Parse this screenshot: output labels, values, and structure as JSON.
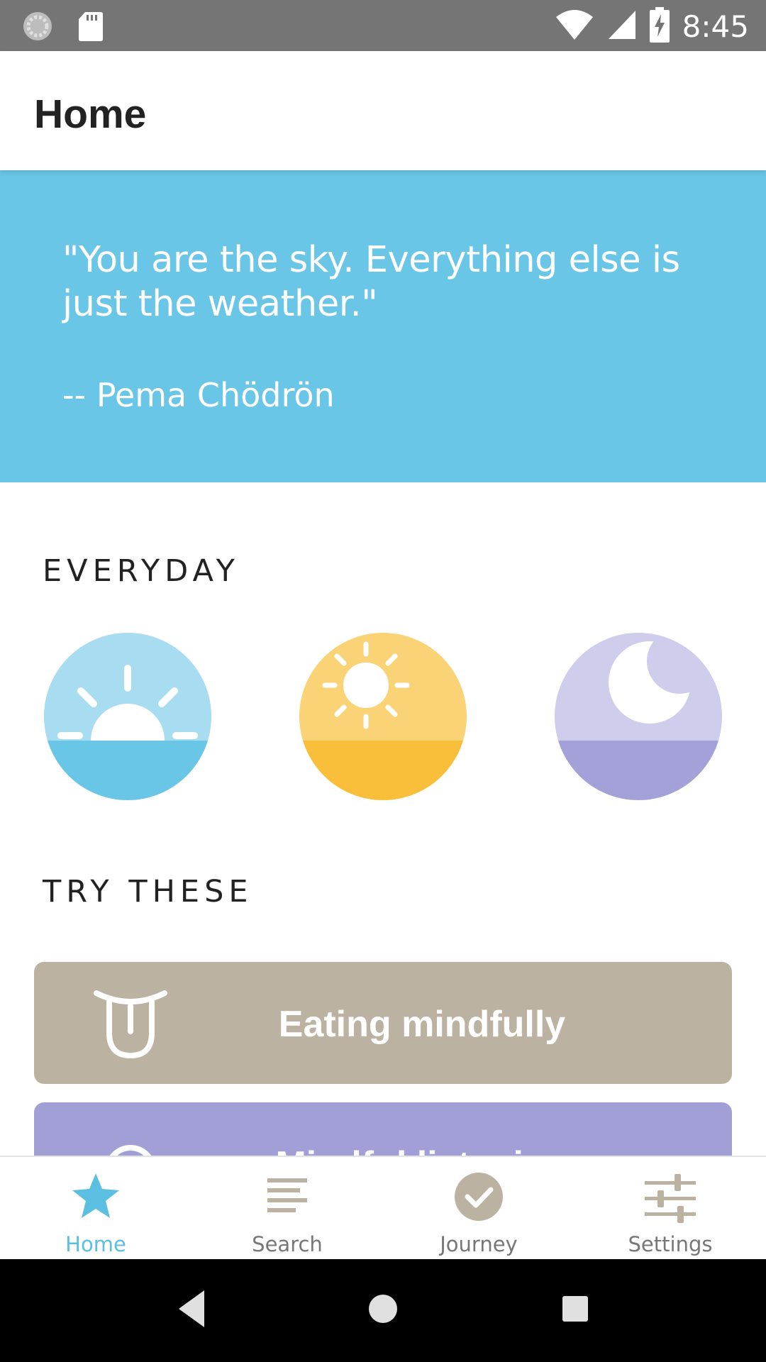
{
  "status_bar": {
    "time": "8:45",
    "icons": [
      "sync-icon",
      "sd-card-icon",
      "wifi-icon",
      "signal-icon",
      "battery-charging-icon"
    ]
  },
  "app_bar": {
    "title": "Home"
  },
  "quote": {
    "text": "\"You are the sky. Everything else is just the weather.\"",
    "author": "-- Pema Chödrön"
  },
  "everyday": {
    "title": "EVERYDAY",
    "items": [
      {
        "icon": "sunrise-icon",
        "colors": {
          "top": "#a8dcf0",
          "bottom": "#6ac6e6"
        }
      },
      {
        "icon": "sun-icon",
        "colors": {
          "top": "#fad377",
          "bottom": "#f9bf3b"
        }
      },
      {
        "icon": "moon-icon",
        "colors": {
          "top": "#cfcdec",
          "bottom": "#a4a1d8"
        }
      }
    ]
  },
  "try_these": {
    "title": "TRY THESE",
    "cards": [
      {
        "label": "Eating mindfully",
        "icon": "tongue-icon",
        "color": "#bcb2a1"
      },
      {
        "label": "Mindful listening",
        "icon": "ear-icon",
        "color": "#a29fd6"
      }
    ]
  },
  "bottom_nav": {
    "items": [
      {
        "label": "Home",
        "icon": "star-icon",
        "active": true
      },
      {
        "label": "Search",
        "icon": "list-icon",
        "active": false
      },
      {
        "label": "Journey",
        "icon": "check-circle-icon",
        "active": false
      },
      {
        "label": "Settings",
        "icon": "sliders-icon",
        "active": false
      }
    ],
    "active_color": "#5bbfe2",
    "inactive_color": "#777777"
  },
  "system_nav": {
    "buttons": [
      "back-icon",
      "home-circle-icon",
      "recents-icon"
    ]
  }
}
